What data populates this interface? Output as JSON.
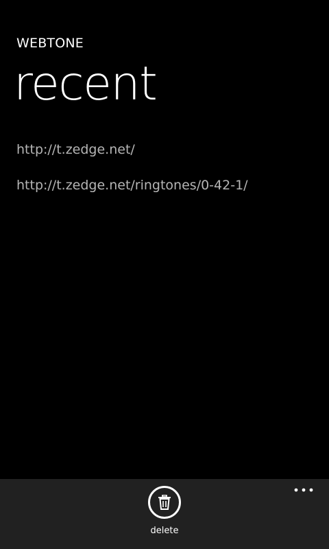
{
  "header": {
    "app_title": "WEBTONE",
    "page_title": "recent"
  },
  "recent": {
    "items": [
      "http://t.zedge.net/",
      "http://t.zedge.net/ringtones/0-42-1/"
    ]
  },
  "app_bar": {
    "delete_label": "delete",
    "delete_icon": "trash-icon",
    "more_icon": "ellipsis-icon",
    "background_color": "#212121"
  }
}
